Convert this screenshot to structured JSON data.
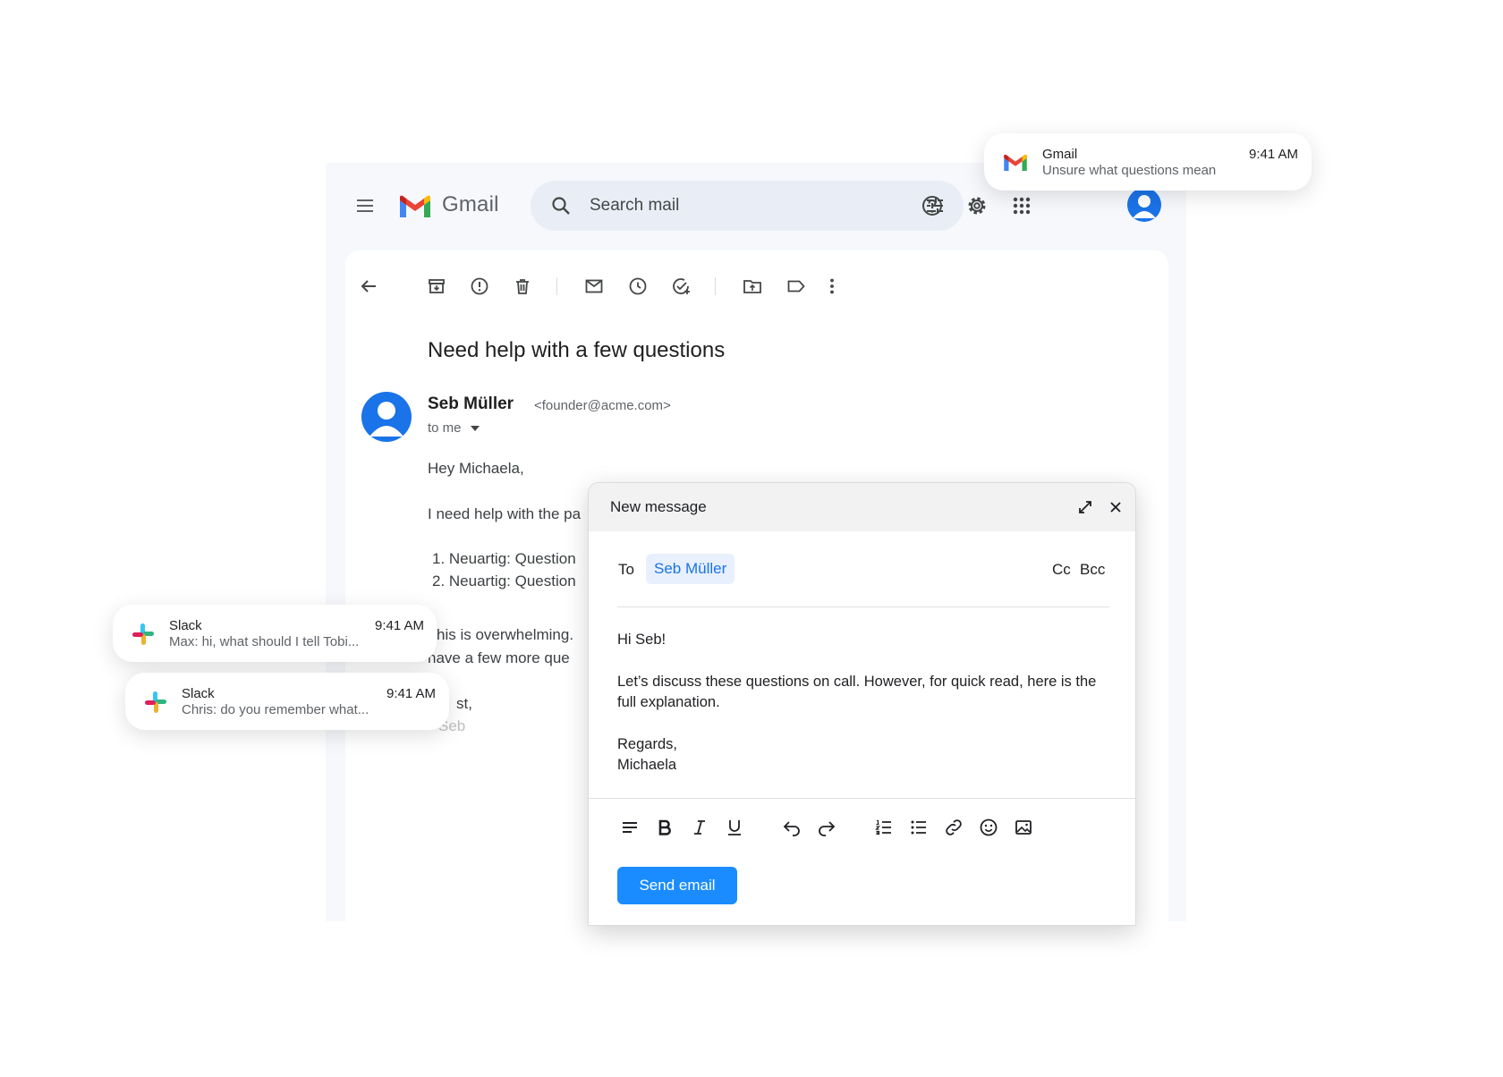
{
  "gmail": {
    "brand": "Gmail",
    "search": {
      "placeholder": "Search mail"
    },
    "colors": {
      "accent": "#1a73e8",
      "send": "#1a8cff",
      "background": "#f6f8fc",
      "search_bg": "#e9eef6"
    },
    "icons": [
      "menu-icon",
      "gmail-logo",
      "search-icon",
      "tune-icon",
      "help-icon",
      "gear-icon",
      "apps-grid-icon",
      "account-avatar"
    ]
  },
  "toolbar": {
    "icons": [
      "back-arrow-icon",
      "archive-icon",
      "report-spam-icon",
      "delete-icon",
      "mark-unread-icon",
      "snooze-icon",
      "add-task-icon",
      "move-to-icon",
      "label-icon",
      "more-vert-icon"
    ]
  },
  "email": {
    "subject": "Need help with a few questions",
    "sender_name": "Seb Müller",
    "sender_email": "<founder@acme.com>",
    "to": "to me",
    "greeting": "Hey Michaela,",
    "line1": "I need help with the pa",
    "item1": "1. Neuartig: Question",
    "item2": "2. Neuartig: Question",
    "line2": "his is overwhelming.",
    "line3": "have a few more que",
    "signoff": "st,",
    "signature": "Seb"
  },
  "compose": {
    "title": "New message",
    "to_label": "To",
    "recipient": "Seb Müller",
    "cc": "Cc",
    "bcc": "Bcc",
    "body_line1": "Hi Seb!",
    "body_line2": "Let’s discuss these questions on call. However, for quick read, here is the full explanation.",
    "body_line3": "Regards,",
    "body_line4": "Michaela",
    "send_label": "Send email",
    "format_icons": [
      "align-icon",
      "bold-icon",
      "italic-icon",
      "underline-icon",
      "undo-icon",
      "redo-icon",
      "numbered-list-icon",
      "bulleted-list-icon",
      "link-icon",
      "emoji-icon",
      "image-icon"
    ]
  },
  "notifications": [
    {
      "app": "Gmail",
      "message": "Unsure what questions mean",
      "time": "9:41 AM"
    },
    {
      "app": "Slack",
      "message": "Max: hi, what should I tell Tobi...",
      "time": "9:41 AM"
    },
    {
      "app": "Slack",
      "message": "Chris: do you remember what...",
      "time": "9:41 AM"
    }
  ]
}
